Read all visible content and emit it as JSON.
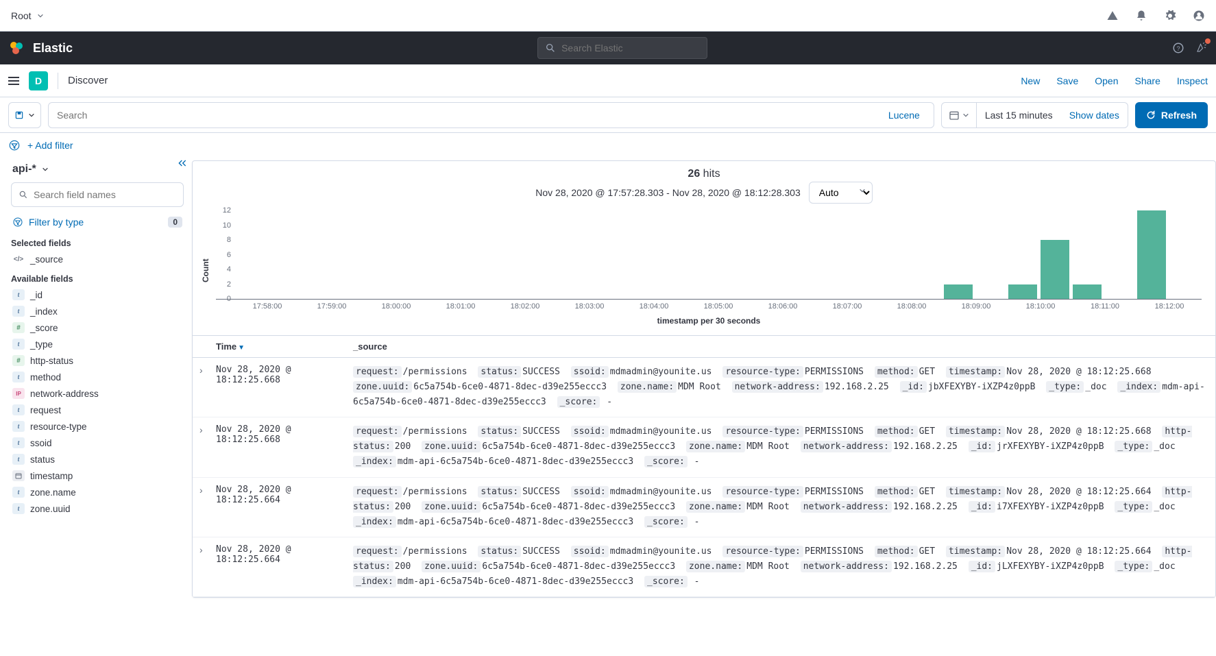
{
  "topbar": {
    "root": "Root"
  },
  "dark": {
    "brand": "Elastic",
    "search_placeholder": "Search Elastic"
  },
  "app": {
    "badge_letter": "D",
    "title": "Discover",
    "actions": [
      "New",
      "Save",
      "Open",
      "Share",
      "Inspect"
    ]
  },
  "query": {
    "search_placeholder": "Search",
    "lang": "Lucene",
    "date_range": "Last 15 minutes",
    "show_dates": "Show dates",
    "refresh": "Refresh"
  },
  "filters": {
    "add_filter": "+ Add filter"
  },
  "sidebar": {
    "index_pattern": "api-*",
    "field_search_placeholder": "Search field names",
    "filter_by_type": "Filter by type",
    "filter_type_count": "0",
    "selected_title": "Selected fields",
    "selected": [
      {
        "badge": "source",
        "name": "_source"
      }
    ],
    "available_title": "Available fields",
    "available": [
      {
        "badge": "t",
        "name": "_id"
      },
      {
        "badge": "t",
        "name": "_index"
      },
      {
        "badge": "hash",
        "name": "_score"
      },
      {
        "badge": "t",
        "name": "_type"
      },
      {
        "badge": "hash",
        "name": "http-status"
      },
      {
        "badge": "t",
        "name": "method"
      },
      {
        "badge": "ip",
        "name": "network-address"
      },
      {
        "badge": "t",
        "name": "request"
      },
      {
        "badge": "t",
        "name": "resource-type"
      },
      {
        "badge": "t",
        "name": "ssoid"
      },
      {
        "badge": "t",
        "name": "status"
      },
      {
        "badge": "clock",
        "name": "timestamp"
      },
      {
        "badge": "t",
        "name": "zone.name"
      },
      {
        "badge": "t",
        "name": "zone.uuid"
      }
    ]
  },
  "hits": {
    "count": "26",
    "suffix": " hits",
    "range": "Nov 28, 2020 @ 17:57:28.303 - Nov 28, 2020 @ 18:12:28.303",
    "interval": "Auto"
  },
  "chart_data": {
    "type": "bar",
    "ylabel": "Count",
    "xlabel": "timestamp per 30 seconds",
    "ylim": [
      0,
      12
    ],
    "yticks": [
      0,
      2,
      4,
      6,
      8,
      10,
      12
    ],
    "xticks": [
      "17:58:00",
      "17:59:00",
      "18:00:00",
      "18:01:00",
      "18:02:00",
      "18:03:00",
      "18:04:00",
      "18:05:00",
      "18:06:00",
      "18:07:00",
      "18:08:00",
      "18:09:00",
      "18:10:00",
      "18:11:00",
      "18:12:00"
    ],
    "bars": [
      {
        "slot": 22,
        "value": 2
      },
      {
        "slot": 24,
        "value": 2
      },
      {
        "slot": 25,
        "value": 8
      },
      {
        "slot": 26,
        "value": 2
      },
      {
        "slot": 28,
        "value": 12
      }
    ],
    "slot_count": 30
  },
  "table": {
    "col_time": "Time",
    "col_source": "_source",
    "rows": [
      {
        "time": "Nov 28, 2020 @ 18:12:25.668",
        "kv": [
          [
            "request:",
            "/permissions"
          ],
          [
            "status:",
            "SUCCESS"
          ],
          [
            "ssoid:",
            "mdmadmin@younite.us"
          ],
          [
            "resource-type:",
            "PERMISSIONS"
          ],
          [
            "method:",
            "GET"
          ],
          [
            "timestamp:",
            "Nov 28, 2020 @ 18:12:25.668"
          ],
          [
            "zone.uuid:",
            "6c5a754b-6ce0-4871-8dec-d39e255eccc3"
          ],
          [
            "zone.name:",
            "MDM Root"
          ],
          [
            "network-address:",
            "192.168.2.25"
          ],
          [
            "_id:",
            "jbXFEXYBY-iXZP4z0ppB"
          ],
          [
            "_type:",
            "_doc"
          ],
          [
            "_index:",
            "mdm-api-6c5a754b-6ce0-4871-8dec-d39e255eccc3"
          ],
          [
            "_score:",
            " -"
          ]
        ]
      },
      {
        "time": "Nov 28, 2020 @ 18:12:25.668",
        "kv": [
          [
            "request:",
            "/permissions"
          ],
          [
            "status:",
            "SUCCESS"
          ],
          [
            "ssoid:",
            "mdmadmin@younite.us"
          ],
          [
            "resource-type:",
            "PERMISSIONS"
          ],
          [
            "method:",
            "GET"
          ],
          [
            "timestamp:",
            "Nov 28, 2020 @ 18:12:25.668"
          ],
          [
            "http-status:",
            "200"
          ],
          [
            "zone.uuid:",
            "6c5a754b-6ce0-4871-8dec-d39e255eccc3"
          ],
          [
            "zone.name:",
            "MDM Root"
          ],
          [
            "network-address:",
            "192.168.2.25"
          ],
          [
            "_id:",
            "jrXFEXYBY-iXZP4z0ppB"
          ],
          [
            "_type:",
            "_doc"
          ],
          [
            "_index:",
            "mdm-api-6c5a754b-6ce0-4871-8dec-d39e255eccc3"
          ],
          [
            "_score:",
            " -"
          ]
        ]
      },
      {
        "time": "Nov 28, 2020 @ 18:12:25.664",
        "kv": [
          [
            "request:",
            "/permissions"
          ],
          [
            "status:",
            "SUCCESS"
          ],
          [
            "ssoid:",
            "mdmadmin@younite.us"
          ],
          [
            "resource-type:",
            "PERMISSIONS"
          ],
          [
            "method:",
            "GET"
          ],
          [
            "timestamp:",
            "Nov 28, 2020 @ 18:12:25.664"
          ],
          [
            "http-status:",
            "200"
          ],
          [
            "zone.uuid:",
            "6c5a754b-6ce0-4871-8dec-d39e255eccc3"
          ],
          [
            "zone.name:",
            "MDM Root"
          ],
          [
            "network-address:",
            "192.168.2.25"
          ],
          [
            "_id:",
            "i7XFEXYBY-iXZP4z0ppB"
          ],
          [
            "_type:",
            "_doc"
          ],
          [
            "_index:",
            "mdm-api-6c5a754b-6ce0-4871-8dec-d39e255eccc3"
          ],
          [
            "_score:",
            " -"
          ]
        ]
      },
      {
        "time": "Nov 28, 2020 @ 18:12:25.664",
        "kv": [
          [
            "request:",
            "/permissions"
          ],
          [
            "status:",
            "SUCCESS"
          ],
          [
            "ssoid:",
            "mdmadmin@younite.us"
          ],
          [
            "resource-type:",
            "PERMISSIONS"
          ],
          [
            "method:",
            "GET"
          ],
          [
            "timestamp:",
            "Nov 28, 2020 @ 18:12:25.664"
          ],
          [
            "http-status:",
            "200"
          ],
          [
            "zone.uuid:",
            "6c5a754b-6ce0-4871-8dec-d39e255eccc3"
          ],
          [
            "zone.name:",
            "MDM Root"
          ],
          [
            "network-address:",
            "192.168.2.25"
          ],
          [
            "_id:",
            "jLXFEXYBY-iXZP4z0ppB"
          ],
          [
            "_type:",
            "_doc"
          ],
          [
            "_index:",
            "mdm-api-6c5a754b-6ce0-4871-8dec-d39e255eccc3"
          ],
          [
            "_score:",
            " -"
          ]
        ]
      }
    ]
  }
}
